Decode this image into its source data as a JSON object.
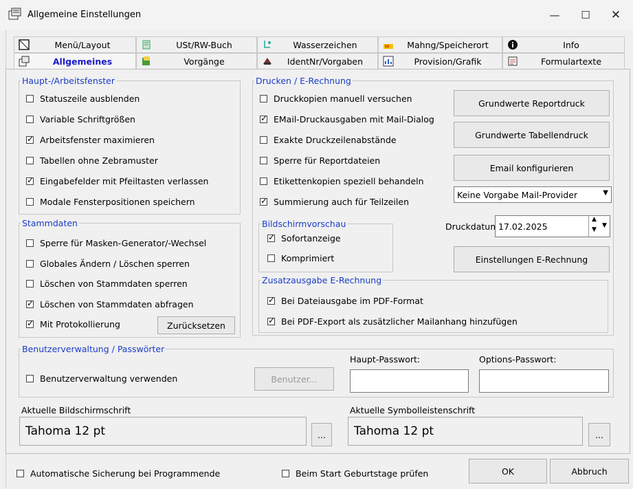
{
  "window": {
    "title": "Allgemeine Einstellungen"
  },
  "tabs_row1": [
    {
      "label": "Menü/Layout",
      "icon": "layout-icon"
    },
    {
      "label": "USt/RW-Buch",
      "icon": "book-icon"
    },
    {
      "label": "Wasserzeichen",
      "icon": "watermark-icon"
    },
    {
      "label": "Mahng/Speicherort",
      "icon": "dunning-icon"
    },
    {
      "label": "Info",
      "icon": "info-icon"
    }
  ],
  "tabs_row2": [
    {
      "label": "Allgemeines",
      "icon": "settings-icon",
      "active": true
    },
    {
      "label": "Vorgänge",
      "icon": "documents-icon"
    },
    {
      "label": "IdentNr/Vorgaben",
      "icon": "ident-icon"
    },
    {
      "label": "Provision/Grafik",
      "icon": "chart-icon"
    },
    {
      "label": "Formulartexte",
      "icon": "form-icon"
    }
  ],
  "haupt": {
    "legend": "Haupt-/Arbeitsfenster",
    "items": [
      {
        "label": "Statuszeile ausblenden",
        "checked": false
      },
      {
        "label": "Variable Schriftgrößen",
        "checked": false
      },
      {
        "label": "Arbeitsfenster maximieren",
        "checked": true
      },
      {
        "label": "Tabellen ohne Zebramuster",
        "checked": false
      },
      {
        "label": "Eingabefelder mit Pfeiltasten verlassen",
        "checked": true
      },
      {
        "label": "Modale Fensterpositionen speichern",
        "checked": false
      }
    ]
  },
  "stamm": {
    "legend": "Stammdaten",
    "items": [
      {
        "label": "Sperre für Masken-Generator/-Wechsel",
        "checked": false
      },
      {
        "label": "Globales Ändern / Löschen sperren",
        "checked": false
      },
      {
        "label": "Löschen von Stammdaten sperren",
        "checked": false
      },
      {
        "label": "Löschen von Stammdaten abfragen",
        "checked": true
      },
      {
        "label": "Mit Protokollierung",
        "checked": true
      }
    ],
    "reset_button": "Zurücksetzen"
  },
  "drucken": {
    "legend": "Drucken / E-Rechnung",
    "items": [
      {
        "label": "Druckkopien manuell versuchen",
        "checked": false
      },
      {
        "label": "EMail-Druckausgaben mit Mail-Dialog",
        "checked": true
      },
      {
        "label": "Exakte Druckzeilenabstände",
        "checked": false
      },
      {
        "label": "Sperre für Reportdateien",
        "checked": false
      },
      {
        "label": "Etikettenkopien speziell behandeln",
        "checked": false
      },
      {
        "label": "Summierung auch für Teilzeilen",
        "checked": true
      }
    ],
    "buttons": [
      "Grundwerte Reportdruck",
      "Grundwerte Tabellendruck",
      "Email konfigurieren"
    ],
    "mail_provider": "Keine Vorgabe Mail-Provider",
    "druckdatum_label": "Druckdatum",
    "druckdatum_value": "17.02.2025",
    "erechnung_button": "Einstellungen E-Rechnung"
  },
  "vorschau": {
    "legend": "Bildschirmvorschau",
    "items": [
      {
        "label": "Sofortanzeige",
        "checked": true
      },
      {
        "label": "Komprimiert",
        "checked": false
      }
    ]
  },
  "zusatz": {
    "legend": "Zusatzausgabe E-Rechnung",
    "items": [
      {
        "label": "Bei Dateiausgabe im PDF-Format",
        "checked": true
      },
      {
        "label": "Bei PDF-Export als zusätzlicher Mailanhang hinzufügen",
        "checked": true
      }
    ]
  },
  "benutzer": {
    "legend": "Benutzerverwaltung / Passwörter",
    "use_label": "Benutzerverwaltung verwenden",
    "use_checked": false,
    "user_button": "Benutzer...",
    "haupt_pw_label": "Haupt-Passwort:",
    "options_pw_label": "Options-Passwort:"
  },
  "fonts": {
    "screen_label": "Aktuelle Bildschirmschrift",
    "screen_value": "Tahoma 12 pt",
    "toolbar_label": "Aktuelle Symbolleistenschrift",
    "toolbar_value": "Tahoma 12 pt",
    "browse": "..."
  },
  "footer": {
    "auto_backup": "Automatische Sicherung bei Programmende",
    "birthdays": "Beim Start Geburtstage prüfen",
    "ok": "OK",
    "cancel": "Abbruch"
  }
}
